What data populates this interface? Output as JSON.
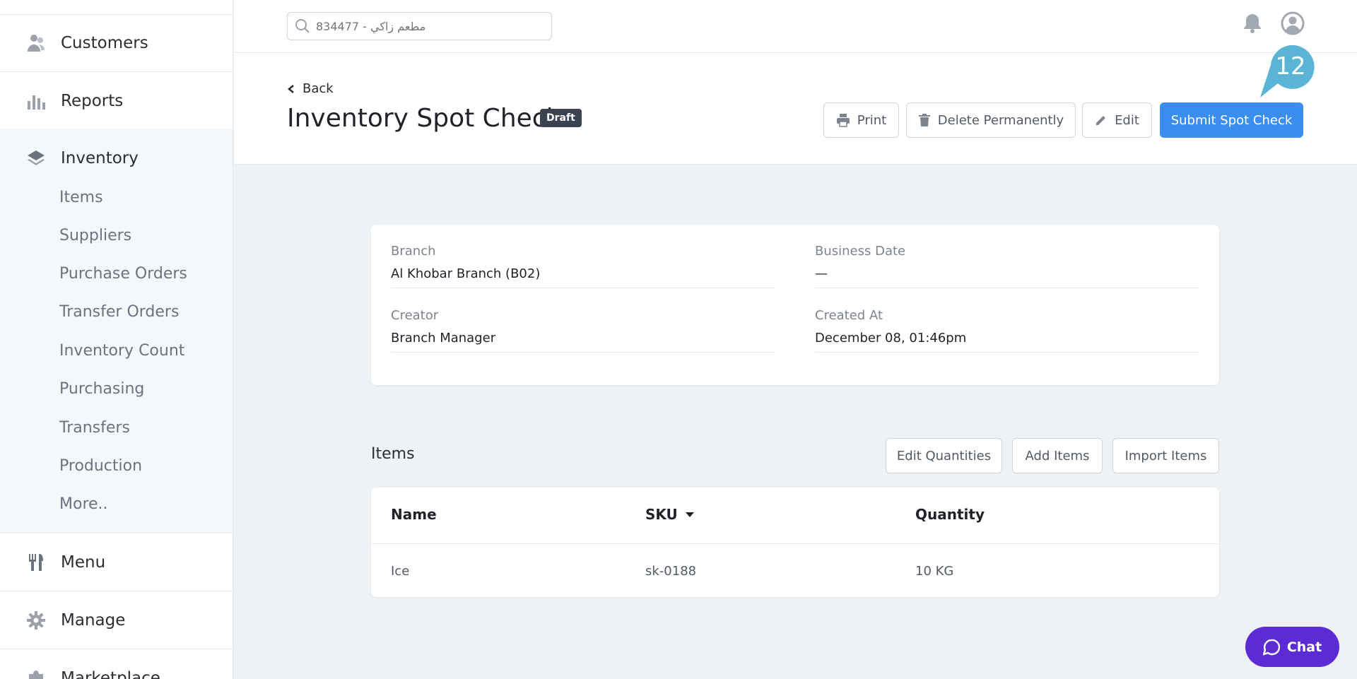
{
  "sidebar": {
    "customers": "Customers",
    "reports": "Reports",
    "inventory": "Inventory",
    "inventory_items": [
      "Items",
      "Suppliers",
      "Purchase Orders",
      "Transfer Orders",
      "Inventory Count",
      "Purchasing",
      "Transfers",
      "Production",
      "More.."
    ],
    "menu": "Menu",
    "manage": "Manage",
    "marketplace": "Marketplace"
  },
  "topbar": {
    "search_placeholder": "مطعم زاكي - 834477"
  },
  "header": {
    "back": "Back",
    "title": "Inventory Spot Check",
    "badge": "Draft",
    "print": "Print",
    "delete": "Delete Permanently",
    "edit": "Edit",
    "submit": "Submit Spot Check",
    "step_number": "12"
  },
  "details": {
    "branch_label": "Branch",
    "branch_value": "Al Khobar Branch (B02)",
    "business_date_label": "Business Date",
    "business_date_value": "—",
    "creator_label": "Creator",
    "creator_value": "Branch Manager",
    "created_at_label": "Created At",
    "created_at_value": "December 08, 01:46pm"
  },
  "items": {
    "title": "Items",
    "edit_quantities": "Edit Quantities",
    "add_items": "Add Items",
    "import_items": "Import Items",
    "columns": [
      "Name",
      "SKU",
      "Quantity"
    ],
    "rows": [
      {
        "name": "Ice",
        "sku": "sk-0188",
        "quantity": "10 KG"
      }
    ]
  },
  "chat": {
    "label": "Chat"
  },
  "colors": {
    "primary": "#3b8ef0",
    "chat": "#5b2bd6",
    "marker": "#5ab4d6",
    "badge": "#3c4350"
  }
}
